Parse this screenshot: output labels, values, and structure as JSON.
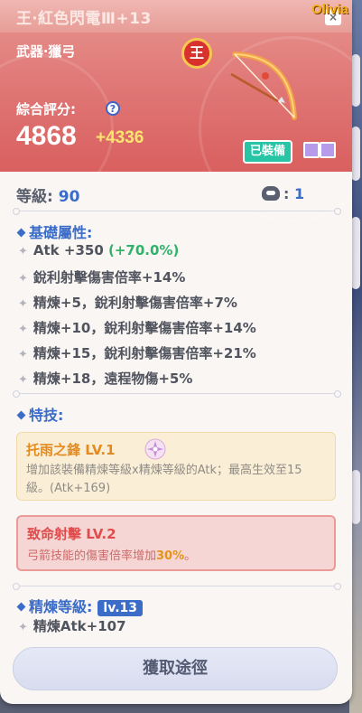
{
  "owner": "Olivia",
  "header": {
    "title": "王‧紅色閃電Ⅲ+13",
    "category": "武器‧獵弓",
    "emblem_glyph": "王",
    "score_label": "綜合評分:",
    "score": "4868",
    "score_bonus": "+4336",
    "equipped_label": "已裝備",
    "close_glyph": "×"
  },
  "level": {
    "label": "等級:",
    "value": "90"
  },
  "resonance": {
    "separator": ":",
    "value": "1",
    "icon": "resonance-icon"
  },
  "base_attributes": {
    "title": "基礎屬性:",
    "items": [
      {
        "text": "Atk +350",
        "extra": "(+70.0%)"
      },
      {
        "text": "銳利射擊傷害倍率+14%"
      },
      {
        "text": "精煉+5，銳利射擊傷害倍率+7%"
      },
      {
        "text": "精煉+10，銳利射擊傷害倍率+14%"
      },
      {
        "text": "精煉+15，銳利射擊傷害倍率+21%"
      },
      {
        "text": "精煉+18，遠程物傷+5%"
      }
    ]
  },
  "skills": {
    "title": "特技:",
    "gold": {
      "name": "托雨之鋒 LV.1",
      "desc": "增加該裝備精煉等級x精煉等級的Atk；最高生效至15級。(Atk+169)"
    },
    "red": {
      "name": "致命射擊 LV.2",
      "desc_pre": "弓箭技能的傷害倍率增加",
      "desc_hl": "30%",
      "desc_post": "。"
    }
  },
  "refine": {
    "title": "精煉等級:",
    "level": "lv.13",
    "bonus": "精煉Atk+107"
  },
  "acquire_button": "獲取途徑",
  "colors": {
    "header": "#e07a78",
    "accent_blue": "#3a6cc8",
    "equipped_green": "#27c4a5",
    "score_bonus": "#fde46f"
  }
}
